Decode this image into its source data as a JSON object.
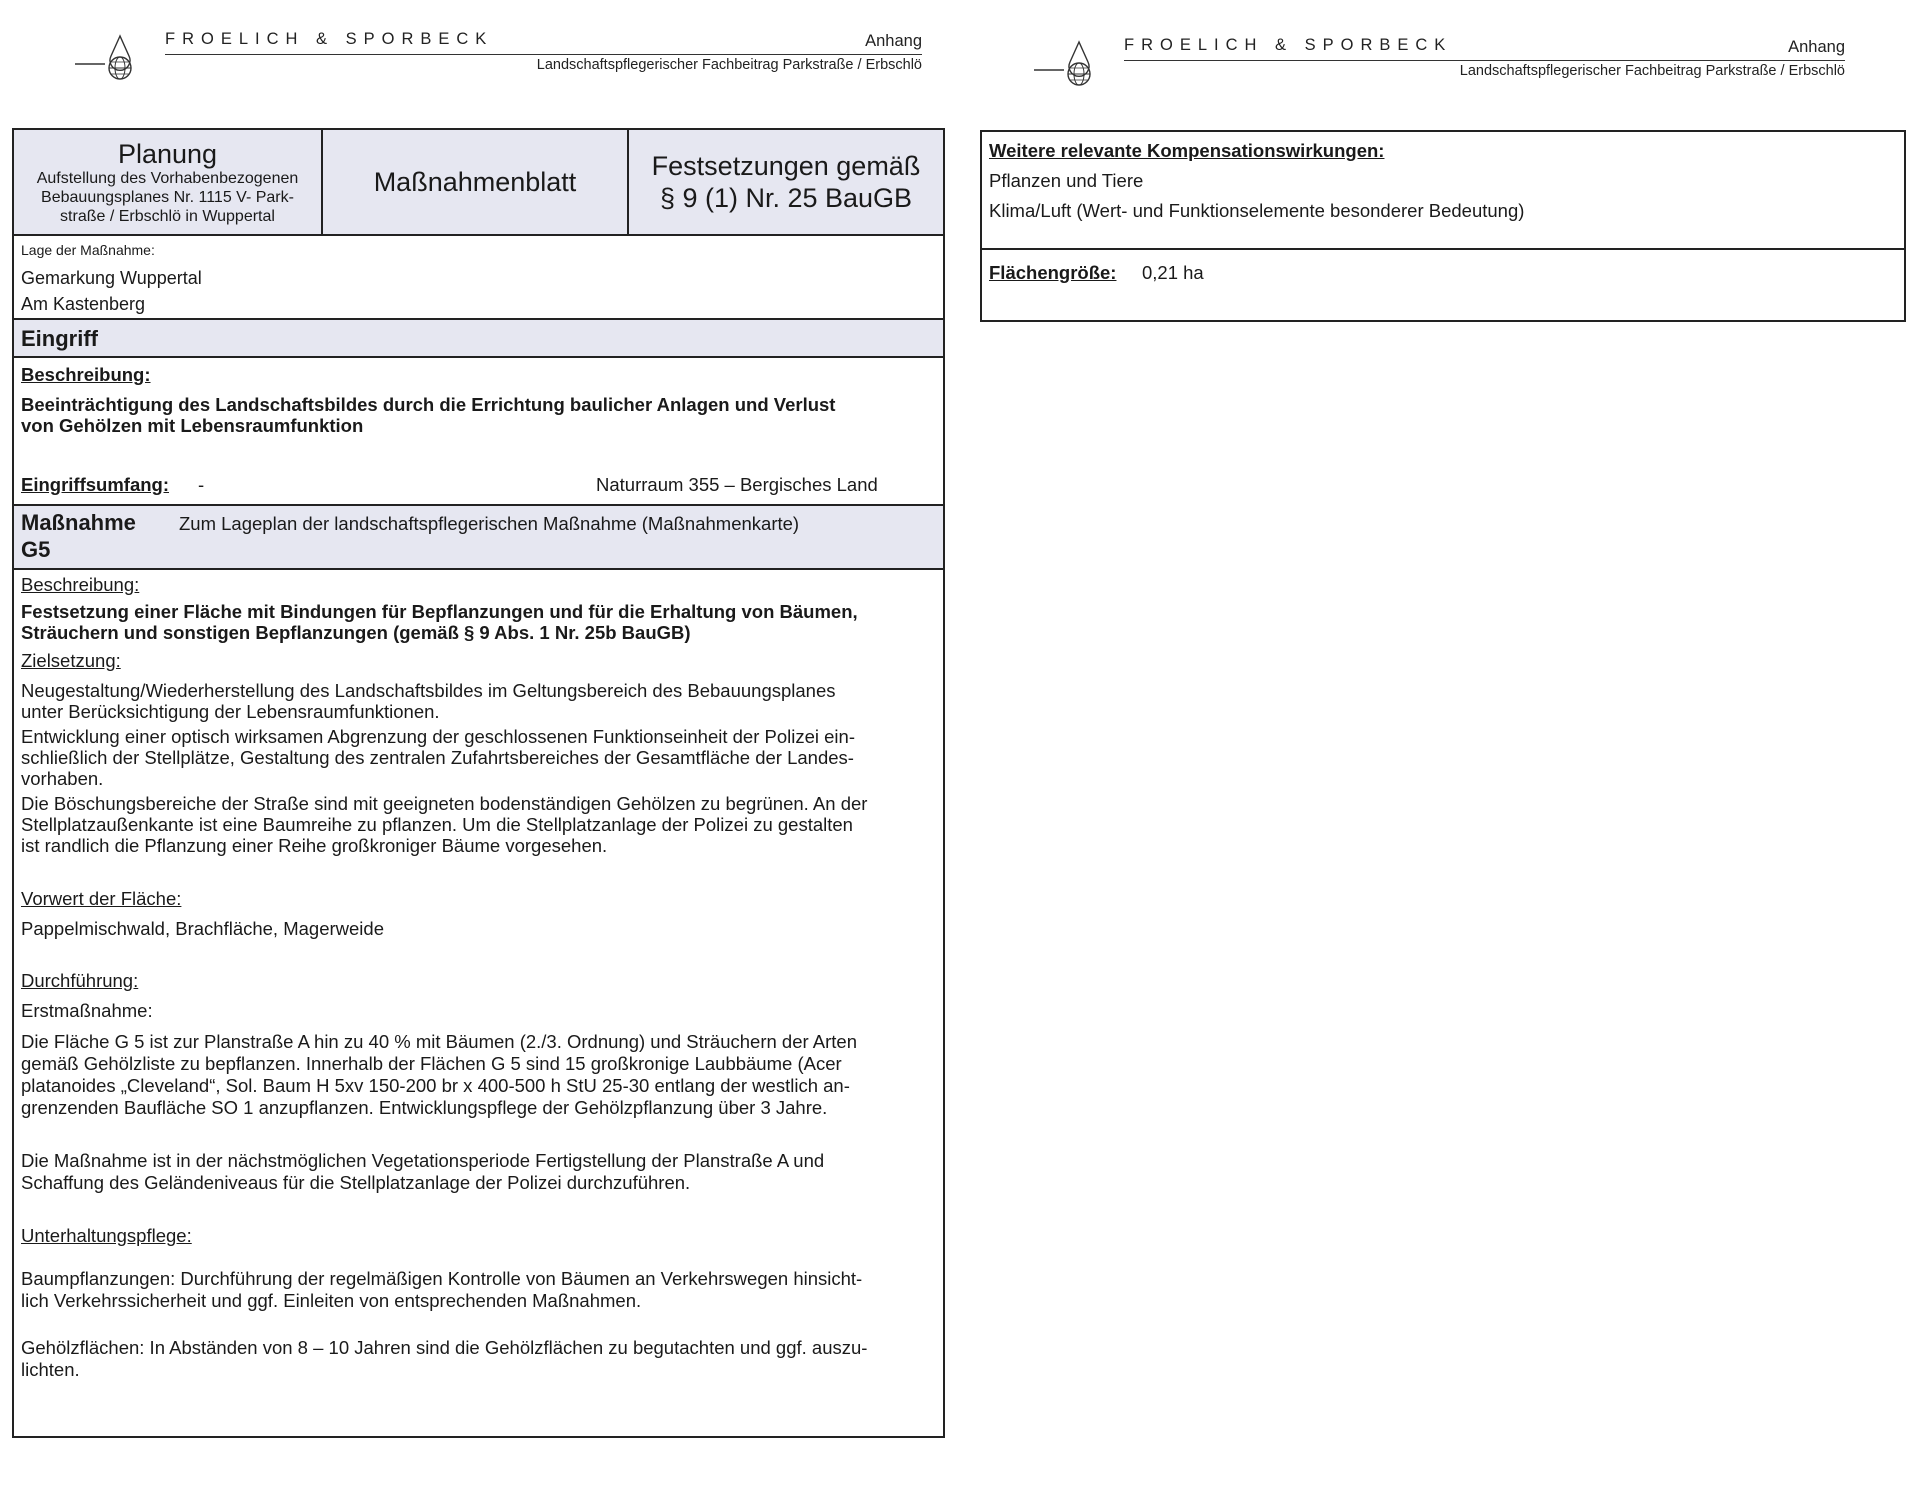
{
  "header": {
    "firm": "FROELICH & SPORBECK",
    "label": "Anhang",
    "subtitle": "Landschaftspflegerischer Fachbeitrag Parkstraße / Erbschlö"
  },
  "form": {
    "planung": {
      "title": "Planung",
      "text": "Aufstellung des Vorhabenbezogenen Bebauungsplanes Nr. 1115 V- Parkstraße / Erbschlö in Wuppertal",
      "line1": "Aufstellung des Vorhabenbezogenen",
      "line2": "Bebauungsplanes Nr. 1115 V- Park-",
      "line3": "straße / Erbschlö in Wuppertal"
    },
    "center_title": "Maßnahmenblatt",
    "right_title_line1": "Festsetzungen gemäß",
    "right_title_line2": "§ 9 (1) Nr. 25 BauGB",
    "lage": {
      "label": "Lage der Maßnahme:",
      "line1": "Gemarkung Wuppertal",
      "line2": "Am Kastenberg"
    },
    "eingriff": {
      "heading": "Eingriff",
      "beschreibung_label": "Beschreibung:",
      "beschreibung_line1": "Beeinträchtigung des Landschaftsbildes durch die Errichtung baulicher Anlagen und Verlust",
      "beschreibung_line2": "von Gehölzen mit Lebensraumfunktion",
      "umfang_label": "Eingriffsumfang:",
      "umfang_value": "-",
      "naturraum": "Naturraum 355 – Bergisches Land"
    },
    "massnahme": {
      "heading_line1": "Maßnahme",
      "heading_line2": "G5",
      "lageplan": "Zum Lageplan der landschaftspflegerischen Maßnahme (Maßnahmenkarte)",
      "beschreibung_label": "Beschreibung:",
      "beschreibung_line1": "Festsetzung einer Fläche mit Bindungen für Bepflanzungen und für die Erhaltung von Bäumen,",
      "beschreibung_line2": "Sträuchern und sonstigen Bepflanzungen (gemäß § 9 Abs. 1 Nr. 25b BauGB)",
      "ziel_label": "Zielsetzung:",
      "ziel_p1_l1": "Neugestaltung/Wiederherstellung des Landschaftsbildes im Geltungsbereich des Bebauungsplanes",
      "ziel_p1_l2": "unter Berücksichtigung der Lebensraumfunktionen.",
      "ziel_p2_l1": "Entwicklung einer optisch wirksamen Abgrenzung der geschlossenen Funktionseinheit der Polizei ein-",
      "ziel_p2_l2": "schließlich der Stellplätze, Gestaltung des zentralen Zufahrtsbereiches der Gesamtfläche der Landes-",
      "ziel_p2_l3": "vorhaben.",
      "ziel_p3_l1": "Die Böschungsbereiche der Straße sind mit geeigneten bodenständigen Gehölzen zu begrünen. An der",
      "ziel_p3_l2": "Stellplatzaußenkante ist eine Baumreihe zu pflanzen. Um die Stellplatzanlage der Polizei zu gestalten",
      "ziel_p3_l3": "ist randlich die Pflanzung einer Reihe großkroniger Bäume vorgesehen.",
      "vorwert_label": "Vorwert der Fläche:",
      "vorwert_value": "Pappelmischwald, Brachfläche, Magerweide",
      "durch_label": "Durchführung:",
      "erst_label": "Erstmaßnahme:",
      "erst_l1": "Die Fläche G 5 ist zur Planstraße A hin zu 40 % mit Bäumen (2./3. Ordnung) und Sträuchern der Arten",
      "erst_l2": "gemäß Gehölzliste zu bepflanzen. Innerhalb der Flächen G 5 sind 15 großkronige Laubbäume (Acer",
      "erst_l3": "platanoides „Cleveland“, Sol. Baum H 5xv 150-200 br x 400-500 h StU 25-30 entlang der westlich an-",
      "erst_l4": "grenzenden Baufläche SO 1 anzupflanzen. Entwicklungspflege der Gehölzpflanzung über 3 Jahre.",
      "zeit_l1": "Die Maßnahme ist in der nächstmöglichen Vegetationsperiode Fertigstellung der Planstraße A und",
      "zeit_l2": "Schaffung des Geländeniveaus für die Stellplatzanlage der Polizei durchzuführen.",
      "pflege_label": "Unterhaltungspflege:",
      "baum_l1": "Baumpflanzungen: Durchführung der regelmäßigen Kontrolle von Bäumen an Verkehrswegen hinsicht-",
      "baum_l2": "lich Verkehrssicherheit und ggf. Einleiten von entsprechenden Maßnahmen.",
      "gehoelz_l1": "Gehölzflächen: In Abständen von 8 – 10 Jahren sind die Gehölzflächen zu begutachten und ggf. auszu-",
      "gehoelz_l2": "lichten."
    }
  },
  "right_form": {
    "heading": "Weitere relevante Kompensationswirkungen:",
    "item1": "Pflanzen und Tiere",
    "item2": "Klima/Luft (Wert- und Funktionselemente besonderer Bedeutung)",
    "flaeche_label": "Flächengröße:",
    "flaeche_value": "0,21 ha"
  },
  "icons": {
    "logo": "globe-drop-logo-icon"
  }
}
